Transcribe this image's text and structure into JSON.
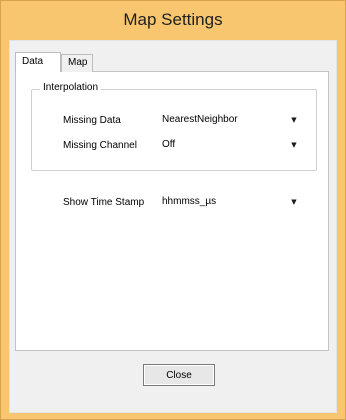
{
  "window": {
    "title": "Map Settings"
  },
  "tabs": [
    {
      "label": "Data",
      "selected": true
    },
    {
      "label": "Map",
      "selected": false
    }
  ],
  "interpolation": {
    "legend": "Interpolation",
    "missing_data": {
      "label": "Missing Data",
      "value": "NearestNeighbor"
    },
    "missing_channel": {
      "label": "Missing Channel",
      "value": "Off"
    }
  },
  "time_stamp": {
    "label": "Show Time Stamp",
    "value": "hhmmss_µs"
  },
  "buttons": {
    "close_label": "Close"
  },
  "colors": {
    "window_frame": "#f8c66f",
    "client_background": "#f0f0f0",
    "panel_background": "#ffffff"
  },
  "icons": {
    "dropdown": "triangle-down-icon"
  }
}
